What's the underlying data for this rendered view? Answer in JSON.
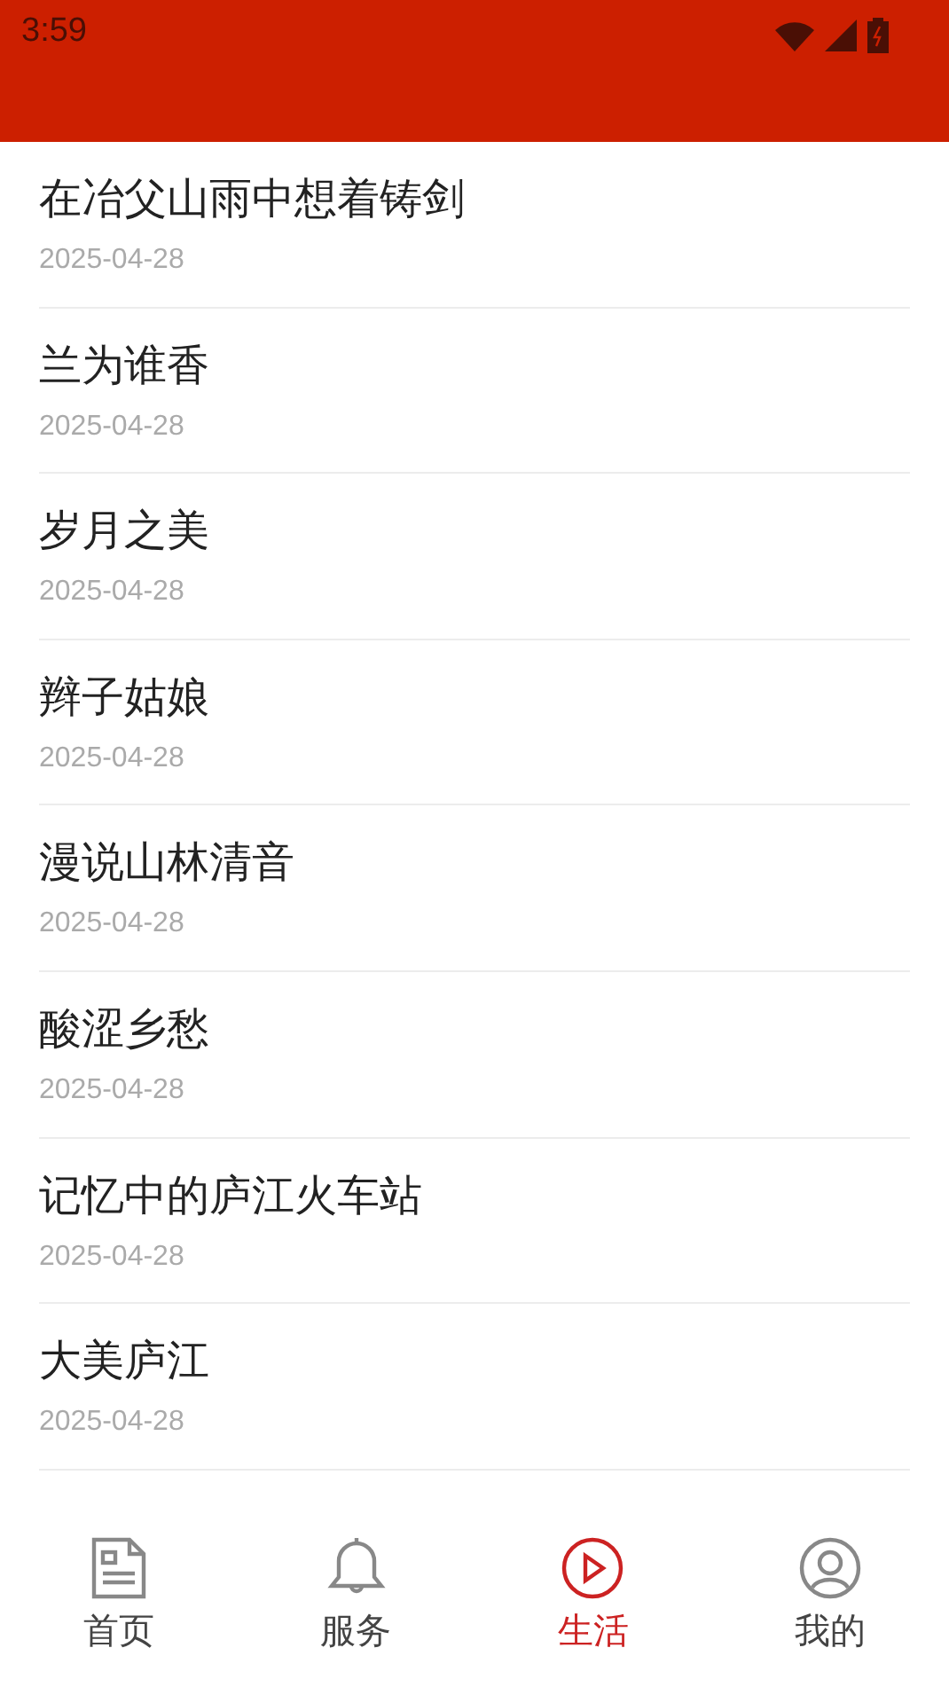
{
  "status_bar": {
    "time": "3:59"
  },
  "articles": [
    {
      "title": "在冶父山雨中想着铸剑",
      "date": "2025-04-28"
    },
    {
      "title": "兰为谁香",
      "date": "2025-04-28"
    },
    {
      "title": "岁月之美",
      "date": "2025-04-28"
    },
    {
      "title": "辫子姑娘",
      "date": "2025-04-28"
    },
    {
      "title": "漫说山林清音",
      "date": "2025-04-28"
    },
    {
      "title": "酸涩乡愁",
      "date": "2025-04-28"
    },
    {
      "title": "记忆中的庐江火车站",
      "date": "2025-04-28"
    },
    {
      "title": "大美庐江",
      "date": "2025-04-28"
    }
  ],
  "bottom_nav": [
    {
      "kind": "news",
      "label": "首页",
      "selected": false
    },
    {
      "kind": "bell",
      "label": "服务",
      "selected": false
    },
    {
      "kind": "play",
      "label": "生活",
      "selected": true
    },
    {
      "kind": "user",
      "label": "我的",
      "selected": false
    }
  ]
}
